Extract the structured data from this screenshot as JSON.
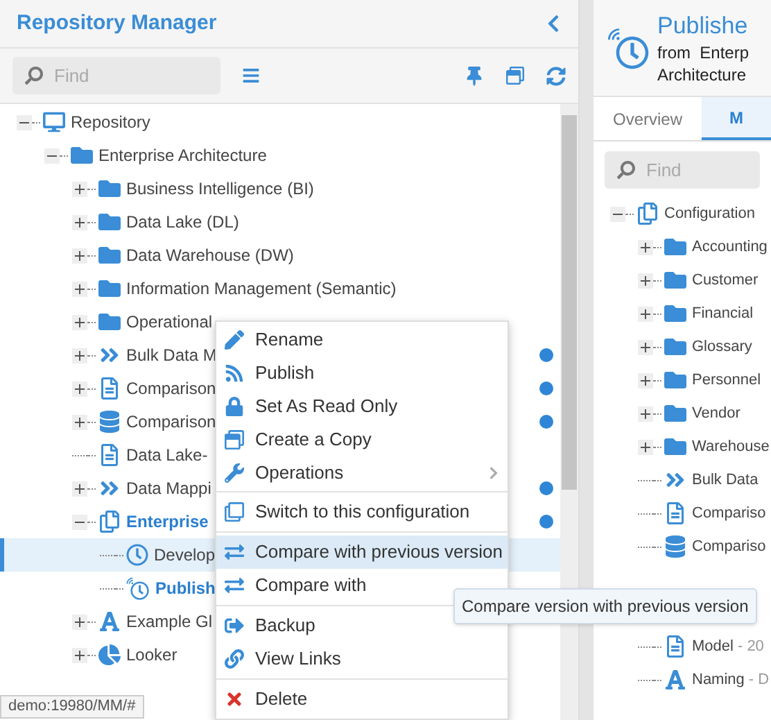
{
  "left_panel": {
    "title": "Repository Manager",
    "find": {
      "placeholder": "Find"
    },
    "tree": [
      {
        "label": "Repository",
        "kind": "repository",
        "expanded": true,
        "selected": false,
        "children": [
          {
            "label": "Enterprise Architecture",
            "kind": "folder",
            "expanded": true,
            "selected": false,
            "children": [
              {
                "label": "Business Intelligence (BI)",
                "kind": "folder",
                "expanded": false,
                "selected": false
              },
              {
                "label": "Data Lake (DL)",
                "kind": "folder",
                "expanded": false,
                "selected": false
              },
              {
                "label": "Data Warehouse (DW)",
                "kind": "folder",
                "expanded": false,
                "selected": false
              },
              {
                "label": "Information Management (Semantic)",
                "kind": "folder",
                "expanded": false,
                "selected": false
              },
              {
                "label": "Operational",
                "kind": "folder",
                "expanded": false,
                "selected": false
              },
              {
                "label": "Bulk Data M",
                "kind": "mapping",
                "expanded": false,
                "selected": false,
                "dot": true
              },
              {
                "label": "Comparison",
                "kind": "document",
                "expanded": false,
                "selected": false,
                "dot": true
              },
              {
                "label": "Comparison",
                "kind": "database",
                "expanded": false,
                "selected": false,
                "dot": true
              },
              {
                "label": "Data Lake-",
                "kind": "document",
                "selected": false
              },
              {
                "label": "Data Mappi",
                "kind": "mapping",
                "expanded": false,
                "selected": false,
                "dot": true
              },
              {
                "label": "Enterprise",
                "kind": "configuration",
                "expanded": true,
                "selected": false,
                "current": true,
                "dot": true,
                "children": [
                  {
                    "label": "Develop",
                    "kind": "version",
                    "selected": true
                  },
                  {
                    "label": "Publish",
                    "kind": "published",
                    "selected": false,
                    "current": true
                  }
                ]
              },
              {
                "label": "Example Gl",
                "kind": "glossary",
                "expanded": false,
                "selected": false
              },
              {
                "label": "Looker",
                "kind": "report",
                "expanded": false,
                "selected": false
              }
            ]
          }
        ]
      }
    ]
  },
  "context_menu": {
    "groups": [
      [
        {
          "label": "Rename",
          "selected": false
        },
        {
          "label": "Publish",
          "selected": false
        },
        {
          "label": "Set As Read Only",
          "selected": false
        },
        {
          "label": "Create a Copy",
          "selected": false
        },
        {
          "label": "Operations",
          "selected": false,
          "submenu": true
        }
      ],
      [
        {
          "label": "Switch to this configuration",
          "selected": false
        }
      ],
      [
        {
          "label": "Compare with previous version",
          "selected": true
        },
        {
          "label": "Compare with",
          "selected": false
        }
      ],
      [
        {
          "label": "Backup",
          "selected": false
        },
        {
          "label": "View Links",
          "selected": false
        }
      ],
      [
        {
          "label": "Delete",
          "selected": false
        }
      ]
    ]
  },
  "tooltip": "Compare version with previous version",
  "status_bar": "demo:19980/MM/#",
  "right_panel": {
    "title": "Publishe",
    "subtitle": [
      "from  Enterp",
      "Architecture"
    ],
    "tabs": [
      {
        "label": "Overview",
        "selected": false
      },
      {
        "label": "M",
        "selected": true
      }
    ],
    "find": {
      "placeholder": "Find"
    },
    "tree": [
      {
        "label": "Configuration",
        "kind": "configuration",
        "expanded": true,
        "children": [
          {
            "label": "Accounting",
            "kind": "folder",
            "expanded": false
          },
          {
            "label": "Customer",
            "kind": "folder",
            "expanded": false
          },
          {
            "label": "Financial",
            "kind": "folder",
            "expanded": false
          },
          {
            "label": "Glossary",
            "kind": "folder",
            "expanded": false
          },
          {
            "label": "Personnel",
            "kind": "folder",
            "expanded": false
          },
          {
            "label": "Vendor",
            "kind": "folder",
            "expanded": false
          },
          {
            "label": "Warehouse",
            "kind": "folder",
            "expanded": false
          },
          {
            "label": "Bulk Data",
            "kind": "mapping"
          },
          {
            "label": "Compariso",
            "kind": "document"
          },
          {
            "label": "Compariso",
            "kind": "database"
          },
          {
            "kind": "hidden"
          },
          {
            "kind": "hidden"
          },
          {
            "label": "Model",
            "suffix": "- 20",
            "kind": "document"
          },
          {
            "label": "Naming",
            "suffix": "- D",
            "kind": "glossary"
          }
        ]
      }
    ]
  }
}
